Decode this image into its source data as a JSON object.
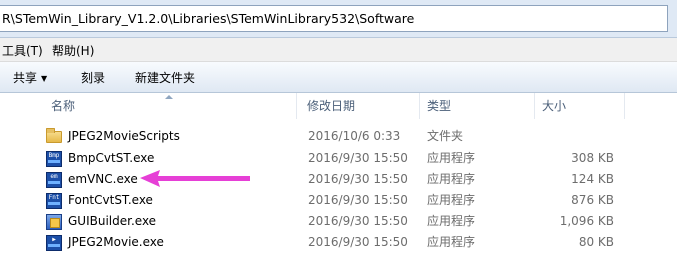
{
  "address_bar": {
    "path": "R\\STemWin_Library_V1.2.0\\Libraries\\STemWinLibrary532\\Software"
  },
  "menu": {
    "items": [
      {
        "label": "工具(T)"
      },
      {
        "label": "帮助(H)"
      }
    ]
  },
  "commands": {
    "share_label": "共享",
    "burn_label": "刻录",
    "new_folder_label": "新建文件夹"
  },
  "columns": {
    "name": "名称",
    "date": "修改日期",
    "type": "类型",
    "size": "大小"
  },
  "files": [
    {
      "name": "JPEG2MovieScripts",
      "date": "2016/10/6 0:33",
      "type": "文件夹",
      "size": "",
      "icon": "folder-icon"
    },
    {
      "name": "BmpCvtST.exe",
      "date": "2016/9/30 15:50",
      "type": "应用程序",
      "size": "308 KB",
      "icon": "bmp-app-icon"
    },
    {
      "name": "emVNC.exe",
      "date": "2016/9/30 15:50",
      "type": "应用程序",
      "size": "124 KB",
      "icon": "em-app-icon"
    },
    {
      "name": "FontCvtST.exe",
      "date": "2016/9/30 15:50",
      "type": "应用程序",
      "size": "876 KB",
      "icon": "font-app-icon"
    },
    {
      "name": "GUIBuilder.exe",
      "date": "2016/9/30 15:50",
      "type": "应用程序",
      "size": "1,096 KB",
      "icon": "gui-app-icon"
    },
    {
      "name": "JPEG2Movie.exe",
      "date": "2016/9/30 15:50",
      "type": "应用程序",
      "size": "80 KB",
      "icon": "movie-app-icon"
    }
  ],
  "annotation": {
    "arrow_color": "#e63fd6",
    "points_to": "emVNC.exe"
  }
}
